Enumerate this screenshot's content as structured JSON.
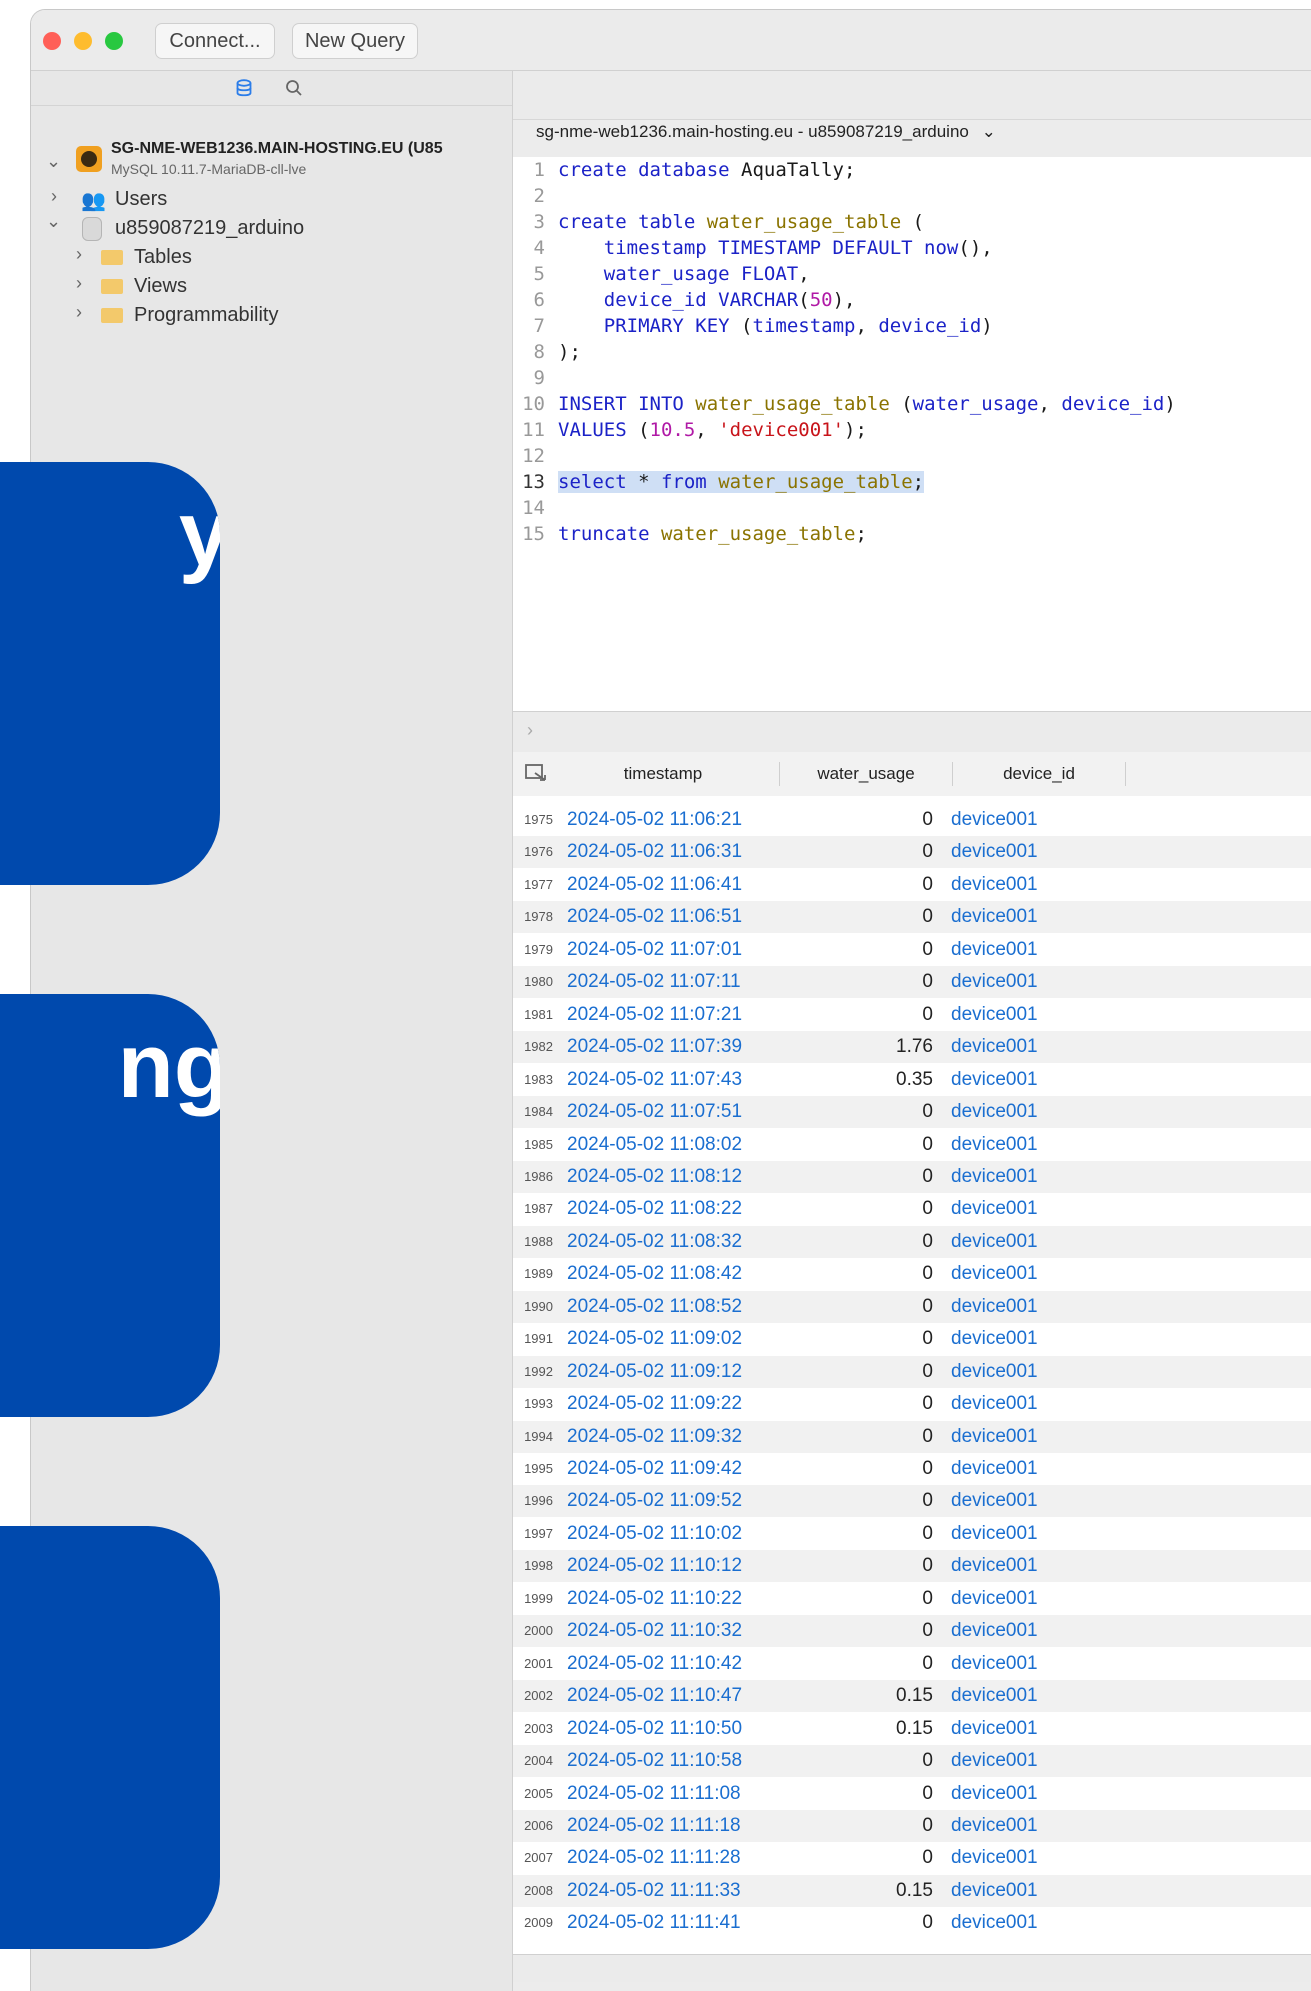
{
  "toolbar": {
    "connect_label": "Connect...",
    "new_query_label": "New Query"
  },
  "traffic_lights": {
    "close": "#ff5f57",
    "minimize": "#febc2e",
    "zoom": "#28c840"
  },
  "sidebar": {
    "server_name": "SG-NME-WEB1236.MAIN-HOSTING.EU (U85",
    "server_version": "MySQL 10.11.7-MariaDB-cll-lve",
    "users_label": "Users",
    "database_name": "u859087219_arduino",
    "tables_label": "Tables",
    "views_label": "Views",
    "programmability_label": "Programmability"
  },
  "editor": {
    "connection": "sg-nme-web1236.main-hosting.eu - u859087219_arduino",
    "line_numbers": [
      "1",
      "2",
      "3",
      "4",
      "5",
      "6",
      "7",
      "8",
      "9",
      "10",
      "11",
      "12",
      "13",
      "14",
      "15"
    ]
  },
  "results": {
    "columns": [
      "timestamp",
      "water_usage",
      "device_id"
    ],
    "rows": [
      {
        "n": "1975",
        "ts": "2024-05-02 11:06:21",
        "wu": "0",
        "dev": "device001"
      },
      {
        "n": "1976",
        "ts": "2024-05-02 11:06:31",
        "wu": "0",
        "dev": "device001"
      },
      {
        "n": "1977",
        "ts": "2024-05-02 11:06:41",
        "wu": "0",
        "dev": "device001"
      },
      {
        "n": "1978",
        "ts": "2024-05-02 11:06:51",
        "wu": "0",
        "dev": "device001"
      },
      {
        "n": "1979",
        "ts": "2024-05-02 11:07:01",
        "wu": "0",
        "dev": "device001"
      },
      {
        "n": "1980",
        "ts": "2024-05-02 11:07:11",
        "wu": "0",
        "dev": "device001"
      },
      {
        "n": "1981",
        "ts": "2024-05-02 11:07:21",
        "wu": "0",
        "dev": "device001"
      },
      {
        "n": "1982",
        "ts": "2024-05-02 11:07:39",
        "wu": "1.76",
        "dev": "device001"
      },
      {
        "n": "1983",
        "ts": "2024-05-02 11:07:43",
        "wu": "0.35",
        "dev": "device001"
      },
      {
        "n": "1984",
        "ts": "2024-05-02 11:07:51",
        "wu": "0",
        "dev": "device001"
      },
      {
        "n": "1985",
        "ts": "2024-05-02 11:08:02",
        "wu": "0",
        "dev": "device001"
      },
      {
        "n": "1986",
        "ts": "2024-05-02 11:08:12",
        "wu": "0",
        "dev": "device001"
      },
      {
        "n": "1987",
        "ts": "2024-05-02 11:08:22",
        "wu": "0",
        "dev": "device001"
      },
      {
        "n": "1988",
        "ts": "2024-05-02 11:08:32",
        "wu": "0",
        "dev": "device001"
      },
      {
        "n": "1989",
        "ts": "2024-05-02 11:08:42",
        "wu": "0",
        "dev": "device001"
      },
      {
        "n": "1990",
        "ts": "2024-05-02 11:08:52",
        "wu": "0",
        "dev": "device001"
      },
      {
        "n": "1991",
        "ts": "2024-05-02 11:09:02",
        "wu": "0",
        "dev": "device001"
      },
      {
        "n": "1992",
        "ts": "2024-05-02 11:09:12",
        "wu": "0",
        "dev": "device001"
      },
      {
        "n": "1993",
        "ts": "2024-05-02 11:09:22",
        "wu": "0",
        "dev": "device001"
      },
      {
        "n": "1994",
        "ts": "2024-05-02 11:09:32",
        "wu": "0",
        "dev": "device001"
      },
      {
        "n": "1995",
        "ts": "2024-05-02 11:09:42",
        "wu": "0",
        "dev": "device001"
      },
      {
        "n": "1996",
        "ts": "2024-05-02 11:09:52",
        "wu": "0",
        "dev": "device001"
      },
      {
        "n": "1997",
        "ts": "2024-05-02 11:10:02",
        "wu": "0",
        "dev": "device001"
      },
      {
        "n": "1998",
        "ts": "2024-05-02 11:10:12",
        "wu": "0",
        "dev": "device001"
      },
      {
        "n": "1999",
        "ts": "2024-05-02 11:10:22",
        "wu": "0",
        "dev": "device001"
      },
      {
        "n": "2000",
        "ts": "2024-05-02 11:10:32",
        "wu": "0",
        "dev": "device001"
      },
      {
        "n": "2001",
        "ts": "2024-05-02 11:10:42",
        "wu": "0",
        "dev": "device001"
      },
      {
        "n": "2002",
        "ts": "2024-05-02 11:10:47",
        "wu": "0.15",
        "dev": "device001"
      },
      {
        "n": "2003",
        "ts": "2024-05-02 11:10:50",
        "wu": "0.15",
        "dev": "device001"
      },
      {
        "n": "2004",
        "ts": "2024-05-02 11:10:58",
        "wu": "0",
        "dev": "device001"
      },
      {
        "n": "2005",
        "ts": "2024-05-02 11:11:08",
        "wu": "0",
        "dev": "device001"
      },
      {
        "n": "2006",
        "ts": "2024-05-02 11:11:18",
        "wu": "0",
        "dev": "device001"
      },
      {
        "n": "2007",
        "ts": "2024-05-02 11:11:28",
        "wu": "0",
        "dev": "device001"
      },
      {
        "n": "2008",
        "ts": "2024-05-02 11:11:33",
        "wu": "0.15",
        "dev": "device001"
      },
      {
        "n": "2009",
        "ts": "2024-05-02 11:11:41",
        "wu": "0",
        "dev": "device001"
      }
    ]
  },
  "overlay_cards": {
    "card1_text": "y",
    "card2_text": "ng",
    "card3_text": "",
    "color": "#0049ad"
  }
}
